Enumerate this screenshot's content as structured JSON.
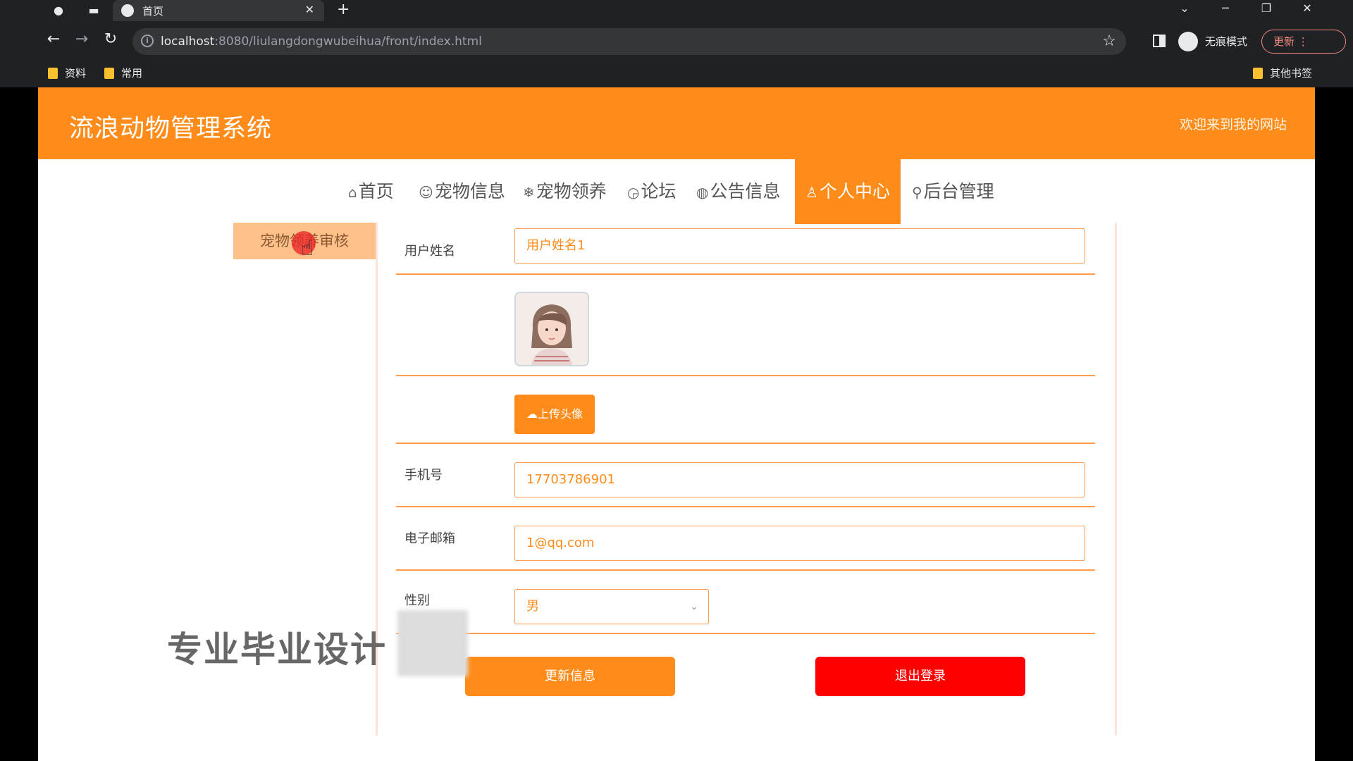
{
  "browser": {
    "tab_title": "首页",
    "url_host": "localhost",
    "url_rest": ":8080/liulangdongwubeihua/front/index.html",
    "incognito_label": "无痕模式",
    "update_label": "更新",
    "bookmarks": [
      "资料",
      "常用"
    ],
    "other_bookmarks": "其他书签"
  },
  "site": {
    "title": "流浪动物管理系统",
    "welcome": "欢迎来到我的网站"
  },
  "nav": {
    "items": [
      {
        "icon": "home-icon",
        "glyph": "⌂",
        "label": "首页"
      },
      {
        "icon": "pet-icon",
        "glyph": "☺",
        "label": "宠物信息"
      },
      {
        "icon": "snowflake-icon",
        "glyph": "❄",
        "label": "宠物领养"
      },
      {
        "icon": "chat-icon",
        "glyph": "◶",
        "label": "论坛"
      },
      {
        "icon": "globe-icon",
        "glyph": "◍",
        "label": "公告信息"
      },
      {
        "icon": "user-icon",
        "glyph": "♙",
        "label": "个人中心"
      },
      {
        "icon": "link-icon",
        "glyph": "⚲",
        "label": "后台管理"
      }
    ],
    "active": "个人中心"
  },
  "side_menu": {
    "item": "宠物领养审核"
  },
  "form": {
    "username_label": "用户姓名",
    "username_value": "用户姓名1",
    "upload_label": "上传头像",
    "phone_label": "手机号",
    "phone_value": "17703786901",
    "email_label": "电子邮箱",
    "email_value": "1@qq.com",
    "gender_label": "性别",
    "gender_value": "男",
    "update_button": "更新信息",
    "logout_button": "退出登录"
  },
  "overlay": {
    "watermark": "专业毕业设计"
  },
  "colors": {
    "brand": "#ff8c1a",
    "danger": "#ff0000"
  }
}
